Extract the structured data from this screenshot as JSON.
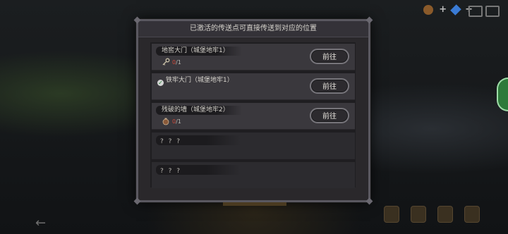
{
  "dialog": {
    "title": "已激活的传送点可直接传送到对应的位置",
    "rows": [
      {
        "name": "地窖大门（城堡地牢1）",
        "progress_num": "0",
        "progress_den": "/1",
        "button": "前往",
        "active": false
      },
      {
        "name": "铁牢大门（城堡地牢1）",
        "button": "前往",
        "active": true
      },
      {
        "name": "残破的墙（城堡地牢2）",
        "progress_num": "0",
        "progress_den": "/1",
        "button": "前往",
        "active": false
      },
      {
        "name": "? ? ?"
      },
      {
        "name": "? ? ?"
      }
    ]
  },
  "colors": {
    "dialog_bg": "#2a282b",
    "row_bg": "#3a383d",
    "progress_red": "#d04a3a",
    "check_green": "#1e7d2e"
  },
  "icons": {
    "row1": "key-icon",
    "row2": "check-icon",
    "row3": "bomb-icon"
  }
}
